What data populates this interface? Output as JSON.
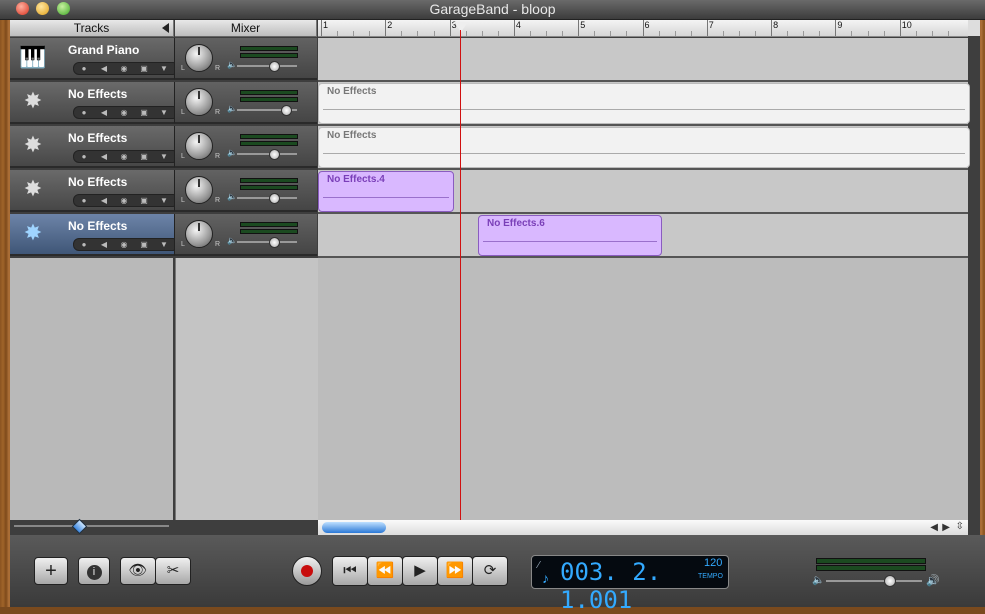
{
  "window": {
    "title": "GarageBand - bloop"
  },
  "headers": {
    "tracks": "Tracks",
    "mixer": "Mixer"
  },
  "ruler": {
    "bars": [
      "1",
      "2",
      "3",
      "4",
      "5",
      "6",
      "7",
      "8",
      "9",
      "10"
    ]
  },
  "tracks": [
    {
      "name": "Grand Piano",
      "icon": "grand-piano-icon",
      "selected": false
    },
    {
      "name": "No Effects",
      "icon": "guitar-amp-icon",
      "selected": false
    },
    {
      "name": "No Effects",
      "icon": "guitar-amp-icon",
      "selected": false
    },
    {
      "name": "No Effects",
      "icon": "guitar-amp-icon",
      "selected": false
    },
    {
      "name": "No Effects",
      "icon": "guitar-amp-icon",
      "selected": true
    }
  ],
  "regions": [
    {
      "name": "No Effects",
      "color": "#f2f2f2"
    },
    {
      "name": "No Effects",
      "color": "#f2f2f2"
    },
    {
      "name": "No Effects.4",
      "color": "#d9b8ff"
    },
    {
      "name": "No Effects.6",
      "color": "#d9b8ff"
    }
  ],
  "lcd": {
    "position": "003. 2. 1.001",
    "tempo_value": "120",
    "tempo_label": "TEMPO"
  },
  "colors": {
    "playhead": "#d01010",
    "lcd_digits": "#33aaff",
    "purple_region": "#d9b8ff"
  }
}
